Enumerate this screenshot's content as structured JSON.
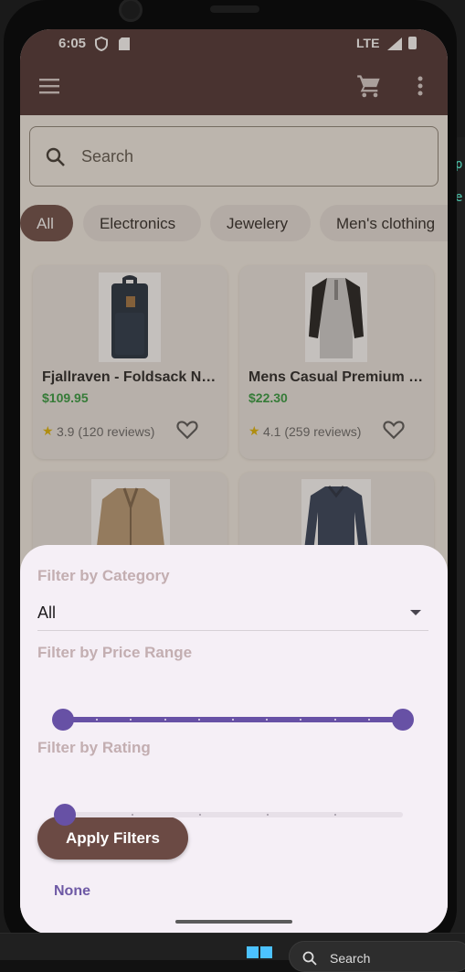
{
  "statusbar": {
    "time": "6:05",
    "network": "LTE"
  },
  "appbar": {
    "menu_icon": "menu-icon",
    "cart_icon": "cart-icon",
    "more_icon": "more-vert-icon"
  },
  "search": {
    "placeholder": "Search"
  },
  "chips": [
    "All",
    "Electronics",
    "Jewelery",
    "Men's clothing"
  ],
  "selected_chip": "All",
  "products": [
    {
      "title": "Fjallraven - Foldsack No...",
      "price": "$109.95",
      "rating": "3.9 (120 reviews)"
    },
    {
      "title": "Mens Casual Premium S...",
      "price": "$22.30",
      "rating": "4.1 (259 reviews)"
    },
    {
      "title": "",
      "price": "",
      "rating": ""
    },
    {
      "title": "",
      "price": "",
      "rating": ""
    }
  ],
  "filter": {
    "category_label": "Filter by Category",
    "category_value": "All",
    "price_label": "Filter by Price Range",
    "price_range_fraction": [
      0,
      1
    ],
    "rating_label": "Filter by Rating",
    "rating_fraction": 0,
    "apply_label": "Apply Filters",
    "none_label": "None"
  },
  "colors": {
    "appbar": "#4a3030",
    "accent": "#6b4a44",
    "slider": "#6751a5",
    "price": "#2e9a3c"
  },
  "taskbar": {
    "search_label": "Search"
  }
}
